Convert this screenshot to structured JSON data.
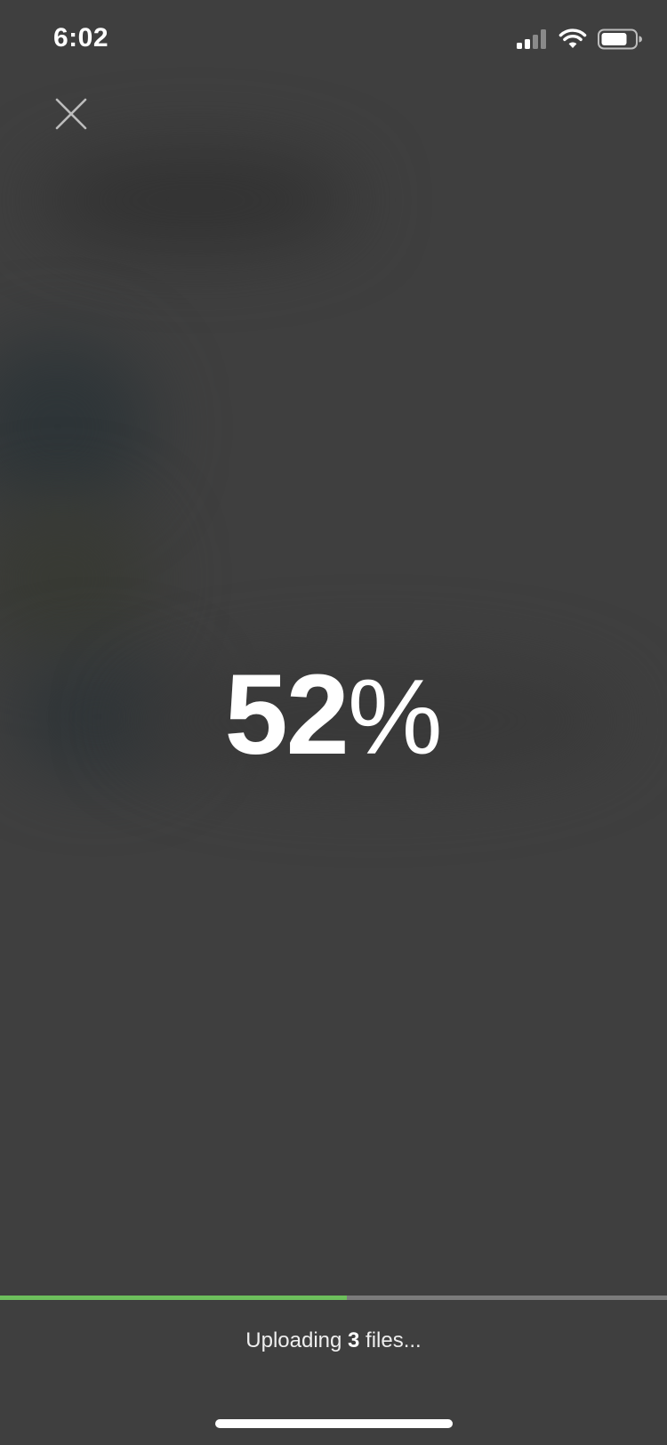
{
  "status_bar": {
    "time": "6:02",
    "icons": [
      "cellular-signal-icon",
      "wifi-icon",
      "battery-icon"
    ]
  },
  "header": {
    "close_icon": "close-icon"
  },
  "upload": {
    "percent_value": "52",
    "percent_sign": "%",
    "progress_fraction": 0.52,
    "status_prefix": "Uploading ",
    "file_count": "3",
    "status_suffix": " files..."
  },
  "colors": {
    "background": "#3f3f3f",
    "progress_fill": "#6dbf5c",
    "progress_track": "#7b7b7b",
    "text": "#ffffff"
  }
}
